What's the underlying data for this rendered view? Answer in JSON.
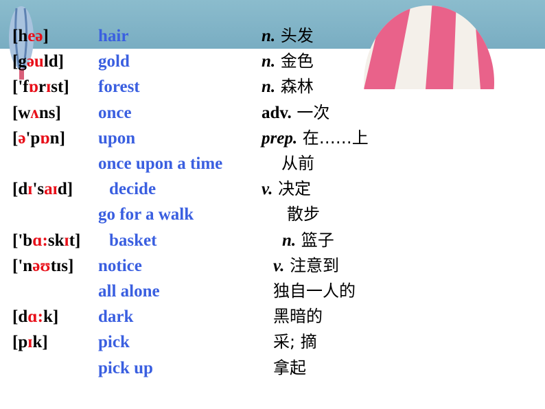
{
  "colors": {
    "phonetic": "#000000",
    "phonetic_highlight": "#e8101a",
    "english": "#3a5fe0",
    "chinese": "#000000",
    "header_band": "#82b4c7"
  },
  "decorations": [
    "blue-hot-air-balloon",
    "pink-striped-hot-air-balloon"
  ],
  "rows": [
    {
      "phonetic": [
        [
          "[h",
          0
        ],
        [
          "eə",
          1
        ],
        [
          "]",
          0
        ]
      ],
      "english": "hair",
      "pos": "n.",
      "pos_italic": true,
      "meaning": "头发"
    },
    {
      "phonetic": [
        [
          "[g",
          0
        ],
        [
          "əu",
          1
        ],
        [
          "ld]",
          0
        ]
      ],
      "english": "gold",
      "pos": "n.",
      "pos_italic": true,
      "meaning": "金色"
    },
    {
      "phonetic": [
        [
          "['f",
          0
        ],
        [
          "ɒ",
          1
        ],
        [
          "r",
          0
        ],
        [
          "ɪ",
          1
        ],
        [
          "st]",
          0
        ]
      ],
      "english": "forest",
      "pos": "n.",
      "pos_italic": true,
      "meaning": "森林"
    },
    {
      "phonetic": [
        [
          "[w",
          0
        ],
        [
          "ʌ",
          1
        ],
        [
          "ns]",
          0
        ]
      ],
      "english": "once",
      "pos": "adv.",
      "pos_italic": false,
      "meaning": "一次"
    },
    {
      "phonetic": [
        [
          "[",
          0
        ],
        [
          "ə",
          1
        ],
        [
          "'p",
          0
        ],
        [
          "ɒ",
          1
        ],
        [
          "n]",
          0
        ]
      ],
      "english": "upon",
      "pos": "prep.",
      "pos_italic": true,
      "meaning": "在……上"
    },
    {
      "phonetic": [],
      "english": "once upon a time",
      "pos": "",
      "pos_italic": false,
      "meaning": "从前"
    },
    {
      "phonetic": [
        [
          "[d",
          0
        ],
        [
          "ɪ",
          1
        ],
        [
          "'s",
          0
        ],
        [
          "aɪ",
          1
        ],
        [
          "d]",
          0
        ]
      ],
      "english": "decide",
      "pos": "v.",
      "pos_italic": true,
      "meaning": "决定"
    },
    {
      "phonetic": [],
      "english": "go for a walk",
      "pos": "",
      "pos_italic": false,
      "meaning": "散步"
    },
    {
      "phonetic": [
        [
          "['b",
          0
        ],
        [
          "ɑ:",
          1
        ],
        [
          "sk",
          0
        ],
        [
          "ɪ",
          1
        ],
        [
          "t]",
          0
        ]
      ],
      "english": "basket",
      "pos": "n.",
      "pos_italic": true,
      "meaning": "篮子"
    },
    {
      "phonetic": [
        [
          "['n",
          0
        ],
        [
          "əʊ",
          1
        ],
        [
          "tɪs]",
          0
        ]
      ],
      "english": "notice",
      "pos": "v.",
      "pos_italic": true,
      "meaning": "注意到"
    },
    {
      "phonetic": [],
      "english": "all alone",
      "pos": "",
      "pos_italic": false,
      "meaning": "独自一人的"
    },
    {
      "phonetic": [
        [
          "[d",
          0
        ],
        [
          "ɑ:",
          1
        ],
        [
          "k]",
          0
        ]
      ],
      "english": "dark",
      "pos": "",
      "pos_italic": false,
      "meaning": "黑暗的"
    },
    {
      "phonetic": [
        [
          "[p",
          0
        ],
        [
          "ɪ",
          1
        ],
        [
          "k]",
          0
        ]
      ],
      "english": "pick",
      "pos": "",
      "pos_italic": false,
      "meaning": "采; 摘"
    },
    {
      "phonetic": [],
      "english": "pick up",
      "pos": "",
      "pos_italic": false,
      "meaning": "拿起"
    }
  ]
}
